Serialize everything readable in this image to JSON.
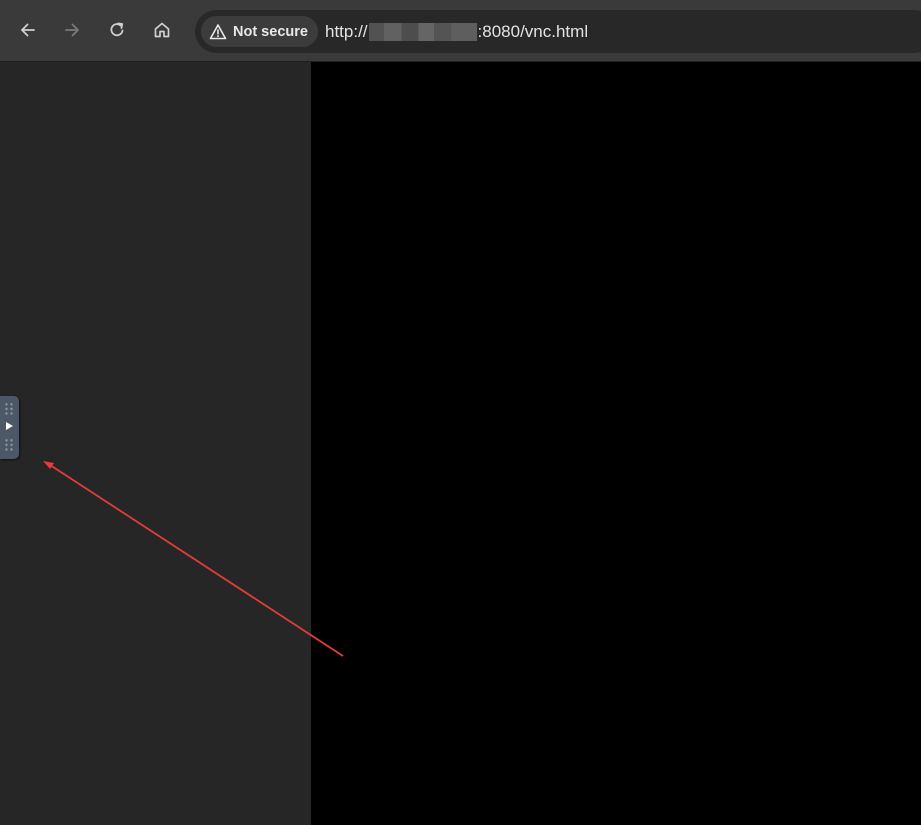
{
  "toolbar": {
    "security": {
      "label": "Not secure",
      "icon": "warning-triangle-icon"
    },
    "url": {
      "prefix": "http://",
      "suffix": ":8080/vnc.html"
    },
    "icons": {
      "back": "arrow-left-icon",
      "forward": "arrow-right-icon",
      "reload": "reload-icon",
      "home": "home-icon"
    }
  },
  "colors": {
    "toolbar_bg": "#3a3a3a",
    "omnibox_bg": "#282828",
    "page_bg": "#262626",
    "canvas_bg": "#000000",
    "handle_bg": "#4d5866",
    "annotation": "#e03c3c"
  },
  "control_bar": {
    "icon": "play-arrow-icon"
  }
}
